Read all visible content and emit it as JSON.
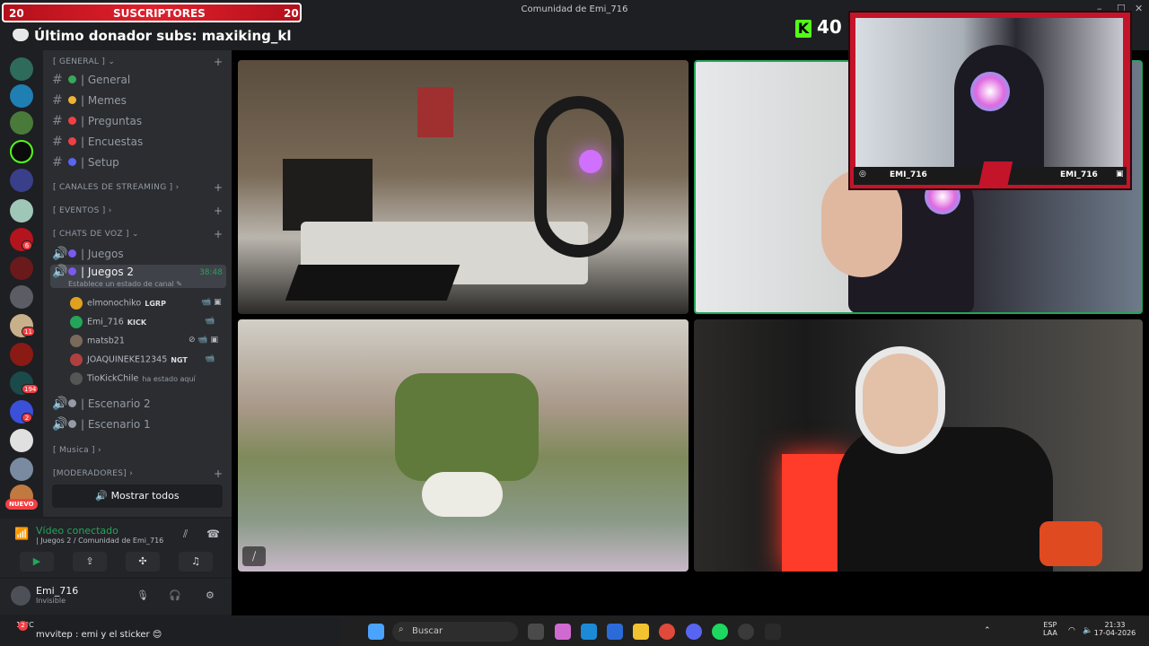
{
  "window": {
    "title": "Comunidad de Emi_716",
    "min": "–",
    "max": "☐",
    "close": "✕"
  },
  "overlay": {
    "sub_count_left": "20",
    "sub_label": "SUSCRIPTORES",
    "sub_count_right": "20",
    "donor_text": "Último donador subs: maxiking_kl",
    "kick_letter": "K",
    "kick_viewers": "40",
    "cam_name_left": "EMI_716",
    "cam_name_right": "EMI_716"
  },
  "server": {
    "categories": [
      {
        "label": "[ GENERAL ] ⌄",
        "add": "+"
      },
      {
        "label": "[ CANALES DE STREAMING ] ›",
        "add": "+"
      },
      {
        "label": "[ EVENTOS ] ›",
        "add": "+"
      },
      {
        "label": "[ CHATS DE VOZ ] ⌄",
        "add": "+"
      },
      {
        "label": "[ Musica ] ›",
        "add": ""
      },
      {
        "label": "[MODERADORES] ›",
        "add": "+"
      }
    ],
    "text_channels": [
      {
        "label": "| General",
        "color": "#3ba55c"
      },
      {
        "label": "| Memes",
        "color": "#f0b232"
      },
      {
        "label": "| Preguntas",
        "color": "#f23f43"
      },
      {
        "label": "| Encuestas",
        "color": "#ed4245"
      },
      {
        "label": "| Setup",
        "color": "#5865f2"
      }
    ],
    "voice_channels": [
      {
        "label": "| Juegos"
      },
      {
        "label": "| Juegos 2",
        "time": "38:48",
        "status": "Establece un estado de canal ✎"
      },
      {
        "label": "| Escenario 2"
      },
      {
        "label": "| Escenario 1"
      }
    ],
    "members": [
      {
        "name": "elmonochiko",
        "tag": "LGRP",
        "icons": "📹 ▣",
        "color": "#e0a020"
      },
      {
        "name": "Emi_716",
        "tag": "KICK",
        "icons": "📹",
        "color": "#23a55a"
      },
      {
        "name": "matsb21",
        "tag": "",
        "icons": "⊘ 📹 ▣",
        "color": "#7a6a5a"
      },
      {
        "name": "JOAQUINEKE12345",
        "tag": "NGT",
        "icons": "📹",
        "color": "#b04040"
      },
      {
        "name": "TioKickChile",
        "tag": "ha estado aquí",
        "icons": "",
        "color": "#555"
      }
    ],
    "show_all": "🔊 Mostrar todos",
    "hash": "#"
  },
  "rail_badges": [
    "6",
    "11",
    "194",
    "2"
  ],
  "nuevo": "NUEVO",
  "voice_panel": {
    "status": "Vídeo conectado",
    "channel": "| Juegos 2 / Comunidad de Emi_716",
    "btn_camera": "▶",
    "btn_screen": "⇪",
    "btn_activity": "✣",
    "btn_soundboard": "♫"
  },
  "user": {
    "name": "Emi_716",
    "status": "Invisible",
    "mic": "🎙",
    "headset": "🎧",
    "settings": "⚙"
  },
  "chat_line": "mvvitep : emi y el sticker 😊",
  "taskbar": {
    "search": "Buscar",
    "weather": "18°C",
    "lang_top": "ESP",
    "lang_bottom": "LAA",
    "time": "21:33",
    "date": "17-04-2026",
    "notif": "2"
  },
  "colors": {
    "accent": "#5865f2",
    "green": "#23a55a",
    "red": "#f23f43",
    "kick": "#53fc18"
  }
}
